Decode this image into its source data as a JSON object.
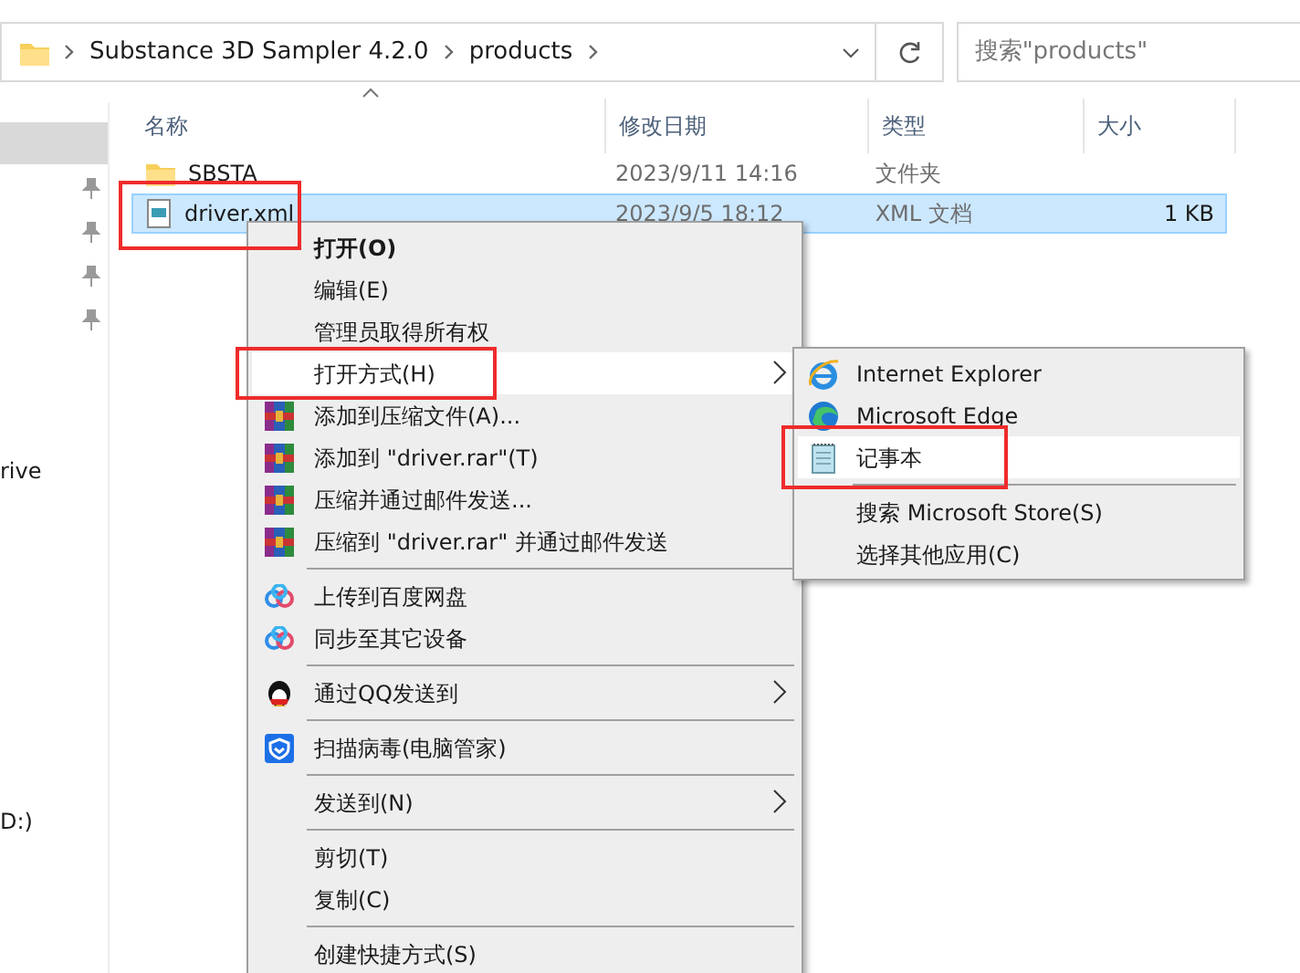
{
  "address_bar": {
    "breadcrumbs": [
      "Substance 3D Sampler 4.2.0",
      "products"
    ]
  },
  "search": {
    "placeholder": "搜索\"products\""
  },
  "nav_pane": {
    "items": [
      {
        "selected": true,
        "pinned": false
      },
      {
        "selected": false,
        "pinned": true
      },
      {
        "selected": false,
        "pinned": true
      },
      {
        "selected": false,
        "pinned": true
      },
      {
        "selected": false,
        "pinned": true
      }
    ],
    "fragments": [
      "rive",
      "D:)"
    ]
  },
  "table": {
    "columns": [
      "名称",
      "修改日期",
      "类型",
      "大小"
    ],
    "rows": [
      {
        "kind": "folder",
        "cells": [
          "SBSTA",
          "2023/9/11 14:16",
          "文件夹",
          ""
        ],
        "selected": false,
        "annotated": false
      },
      {
        "kind": "xml",
        "cells": [
          "driver.xml",
          "2023/9/5 18:12",
          "XML 文档",
          "1 KB"
        ],
        "selected": true,
        "annotated": true
      }
    ]
  },
  "context_menu": {
    "items": [
      {
        "kind": "plain",
        "label": "打开(O)",
        "default": true,
        "selected": false,
        "submenu": false,
        "annotated": false
      },
      {
        "kind": "plain",
        "label": "编辑(E)",
        "default": false,
        "selected": false,
        "submenu": false,
        "annotated": false
      },
      {
        "kind": "plain",
        "label": "管理员取得所有权",
        "default": false,
        "selected": false,
        "submenu": false,
        "annotated": false
      },
      {
        "kind": "plain",
        "label": "打开方式(H)",
        "default": false,
        "selected": true,
        "submenu": true,
        "annotated": true
      },
      {
        "kind": "archive",
        "label": "添加到压缩文件(A)...",
        "default": false,
        "selected": false,
        "submenu": false,
        "annotated": false
      },
      {
        "kind": "archive",
        "label": "添加到 \"driver.rar\"(T)",
        "default": false,
        "selected": false,
        "submenu": false,
        "annotated": false
      },
      {
        "kind": "archive",
        "label": "压缩并通过邮件发送...",
        "default": false,
        "selected": false,
        "submenu": false,
        "annotated": false
      },
      {
        "kind": "archive",
        "label": "压缩到 \"driver.rar\" 并通过邮件发送",
        "default": false,
        "selected": false,
        "submenu": false,
        "annotated": false
      },
      {
        "kind": "separator"
      },
      {
        "kind": "cloud",
        "label": "上传到百度网盘",
        "default": false,
        "selected": false,
        "submenu": false,
        "annotated": false
      },
      {
        "kind": "cloud",
        "label": "同步至其它设备",
        "default": false,
        "selected": false,
        "submenu": false,
        "annotated": false
      },
      {
        "kind": "separator"
      },
      {
        "kind": "penguin",
        "label": "通过QQ发送到",
        "default": false,
        "selected": false,
        "submenu": true,
        "annotated": false
      },
      {
        "kind": "separator"
      },
      {
        "kind": "shield",
        "label": "扫描病毒(电脑管家)",
        "default": false,
        "selected": false,
        "submenu": false,
        "annotated": false
      },
      {
        "kind": "separator"
      },
      {
        "kind": "plain",
        "label": "发送到(N)",
        "default": false,
        "selected": false,
        "submenu": true,
        "annotated": false
      },
      {
        "kind": "separator"
      },
      {
        "kind": "plain",
        "label": "剪切(T)",
        "default": false,
        "selected": false,
        "submenu": false,
        "annotated": false
      },
      {
        "kind": "plain",
        "label": "复制(C)",
        "default": false,
        "selected": false,
        "submenu": false,
        "annotated": false
      },
      {
        "kind": "separator"
      },
      {
        "kind": "plain",
        "label": "创建快捷方式(S)",
        "default": false,
        "selected": false,
        "submenu": false,
        "annotated": false
      }
    ]
  },
  "open_with_menu": {
    "items": [
      {
        "kind": "ie",
        "label": "Internet Explorer",
        "selected": false,
        "annotated": false
      },
      {
        "kind": "edge",
        "label": "Microsoft Edge",
        "selected": false,
        "annotated": false
      },
      {
        "kind": "notepad",
        "label": "记事本",
        "selected": true,
        "annotated": true
      },
      {
        "kind": "separator"
      },
      {
        "kind": "plain",
        "label": "搜索 Microsoft Store(S)",
        "selected": false,
        "annotated": false
      },
      {
        "kind": "plain",
        "label": "选择其他应用(C)",
        "selected": false,
        "annotated": false
      }
    ]
  }
}
